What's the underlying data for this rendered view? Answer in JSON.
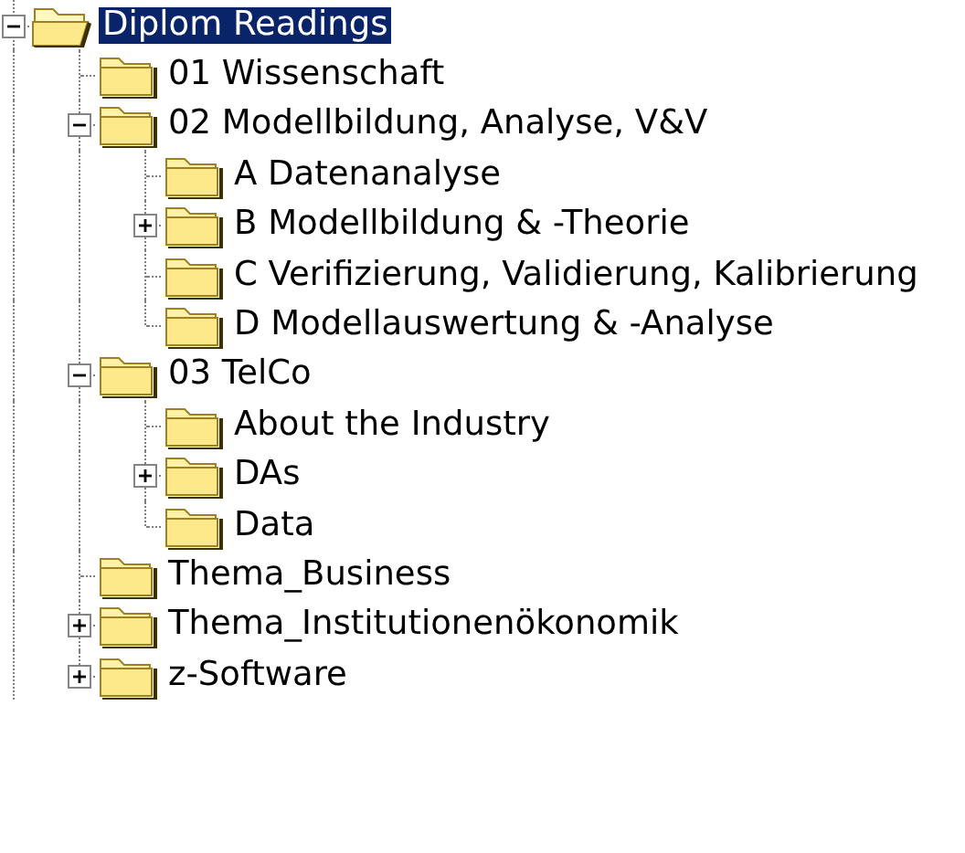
{
  "tree": {
    "label": "Diplom Readings",
    "selected": true,
    "expanded": true,
    "children": [
      {
        "label": "01 Wissenschaft",
        "selected": false
      },
      {
        "label": "02 Modellbildung, Analyse, V&V",
        "selected": false,
        "expanded": true,
        "children": [
          {
            "label": "A Datenanalyse",
            "selected": false
          },
          {
            "label": "B Modellbildung & -Theorie",
            "selected": false,
            "expanded": false
          },
          {
            "label": "C Verifizierung, Validierung, Kalibrierung",
            "selected": false
          },
          {
            "label": "D Modellauswertung & -Analyse",
            "selected": false
          }
        ]
      },
      {
        "label": "03 TelCo",
        "selected": false,
        "expanded": true,
        "children": [
          {
            "label": "About the Industry",
            "selected": false
          },
          {
            "label": "DAs",
            "selected": false,
            "expanded": false
          },
          {
            "label": "Data",
            "selected": false
          }
        ]
      },
      {
        "label": "Thema_Business",
        "selected": false
      },
      {
        "label": "Thema_Institutionenökonomik",
        "selected": false,
        "expanded": false
      },
      {
        "label": "z-Software",
        "selected": false,
        "expanded": false
      }
    ]
  }
}
